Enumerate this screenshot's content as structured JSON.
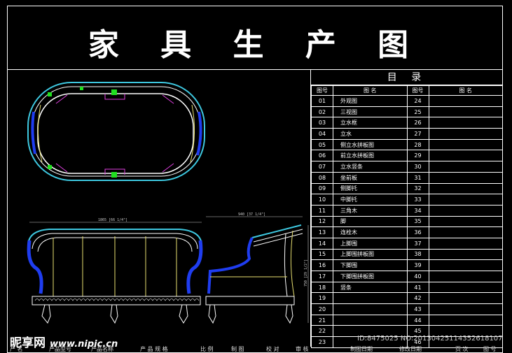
{
  "title": "家 具 生 产 图",
  "catalog": {
    "heading": "目 录",
    "columns": [
      "图号",
      "图 名",
      "图号",
      "图 名"
    ],
    "rows": [
      {
        "no": "01",
        "name": "外观图",
        "no2": "24",
        "name2": ""
      },
      {
        "no": "02",
        "name": "三视图",
        "no2": "25",
        "name2": ""
      },
      {
        "no": "03",
        "name": "立水框",
        "no2": "26",
        "name2": ""
      },
      {
        "no": "04",
        "name": "立水",
        "no2": "27",
        "name2": ""
      },
      {
        "no": "05",
        "name": "侧立水拼板图",
        "no2": "28",
        "name2": ""
      },
      {
        "no": "06",
        "name": "前立水拼板图",
        "no2": "29",
        "name2": ""
      },
      {
        "no": "07",
        "name": "立水竖条",
        "no2": "30",
        "name2": ""
      },
      {
        "no": "08",
        "name": "坐前板",
        "no2": "31",
        "name2": ""
      },
      {
        "no": "09",
        "name": "侧脚托",
        "no2": "32",
        "name2": ""
      },
      {
        "no": "10",
        "name": "中脚托",
        "no2": "33",
        "name2": ""
      },
      {
        "no": "11",
        "name": "三角木",
        "no2": "34",
        "name2": ""
      },
      {
        "no": "12",
        "name": "脚",
        "no2": "35",
        "name2": ""
      },
      {
        "no": "13",
        "name": "连栓木",
        "no2": "36",
        "name2": ""
      },
      {
        "no": "14",
        "name": "上脚围",
        "no2": "37",
        "name2": ""
      },
      {
        "no": "15",
        "name": "上脚围拼板图",
        "no2": "38",
        "name2": ""
      },
      {
        "no": "16",
        "name": "下脚围",
        "no2": "39",
        "name2": ""
      },
      {
        "no": "17",
        "name": "下脚围拼板图",
        "no2": "40",
        "name2": ""
      },
      {
        "no": "18",
        "name": "竖条",
        "no2": "41",
        "name2": ""
      },
      {
        "no": "19",
        "name": "",
        "no2": "42",
        "name2": ""
      },
      {
        "no": "20",
        "name": "",
        "no2": "43",
        "name2": ""
      },
      {
        "no": "21",
        "name": "",
        "no2": "44",
        "name2": ""
      },
      {
        "no": "22",
        "name": "",
        "no2": "45",
        "name2": ""
      },
      {
        "no": "23",
        "name": "",
        "no2": "46",
        "name2": ""
      }
    ]
  },
  "dimensions": {
    "front_width": "1865 [66 1/4\"]",
    "side_depth": "940 [37 1/4\"]",
    "side_height": "750 [29 1/2\"]"
  },
  "footer_labels": [
    "产 名",
    "产品型号",
    "产品名称",
    "产 品 规 格",
    "比 例",
    "制 图",
    "校 对",
    "审 核",
    "制图日期",
    "修改日期",
    "页 次",
    "图 号"
  ],
  "watermark": {
    "brand": "昵享网",
    "url": "www.nipic.cn",
    "id": "ID:8475025 NO:20130425114352618107"
  },
  "colors": {
    "line": "#ffffff",
    "cyan": "#3ec8e0",
    "blue": "#1f3df0",
    "yellow": "#e8e070",
    "green": "#20e020",
    "magenta": "#e040e0"
  }
}
